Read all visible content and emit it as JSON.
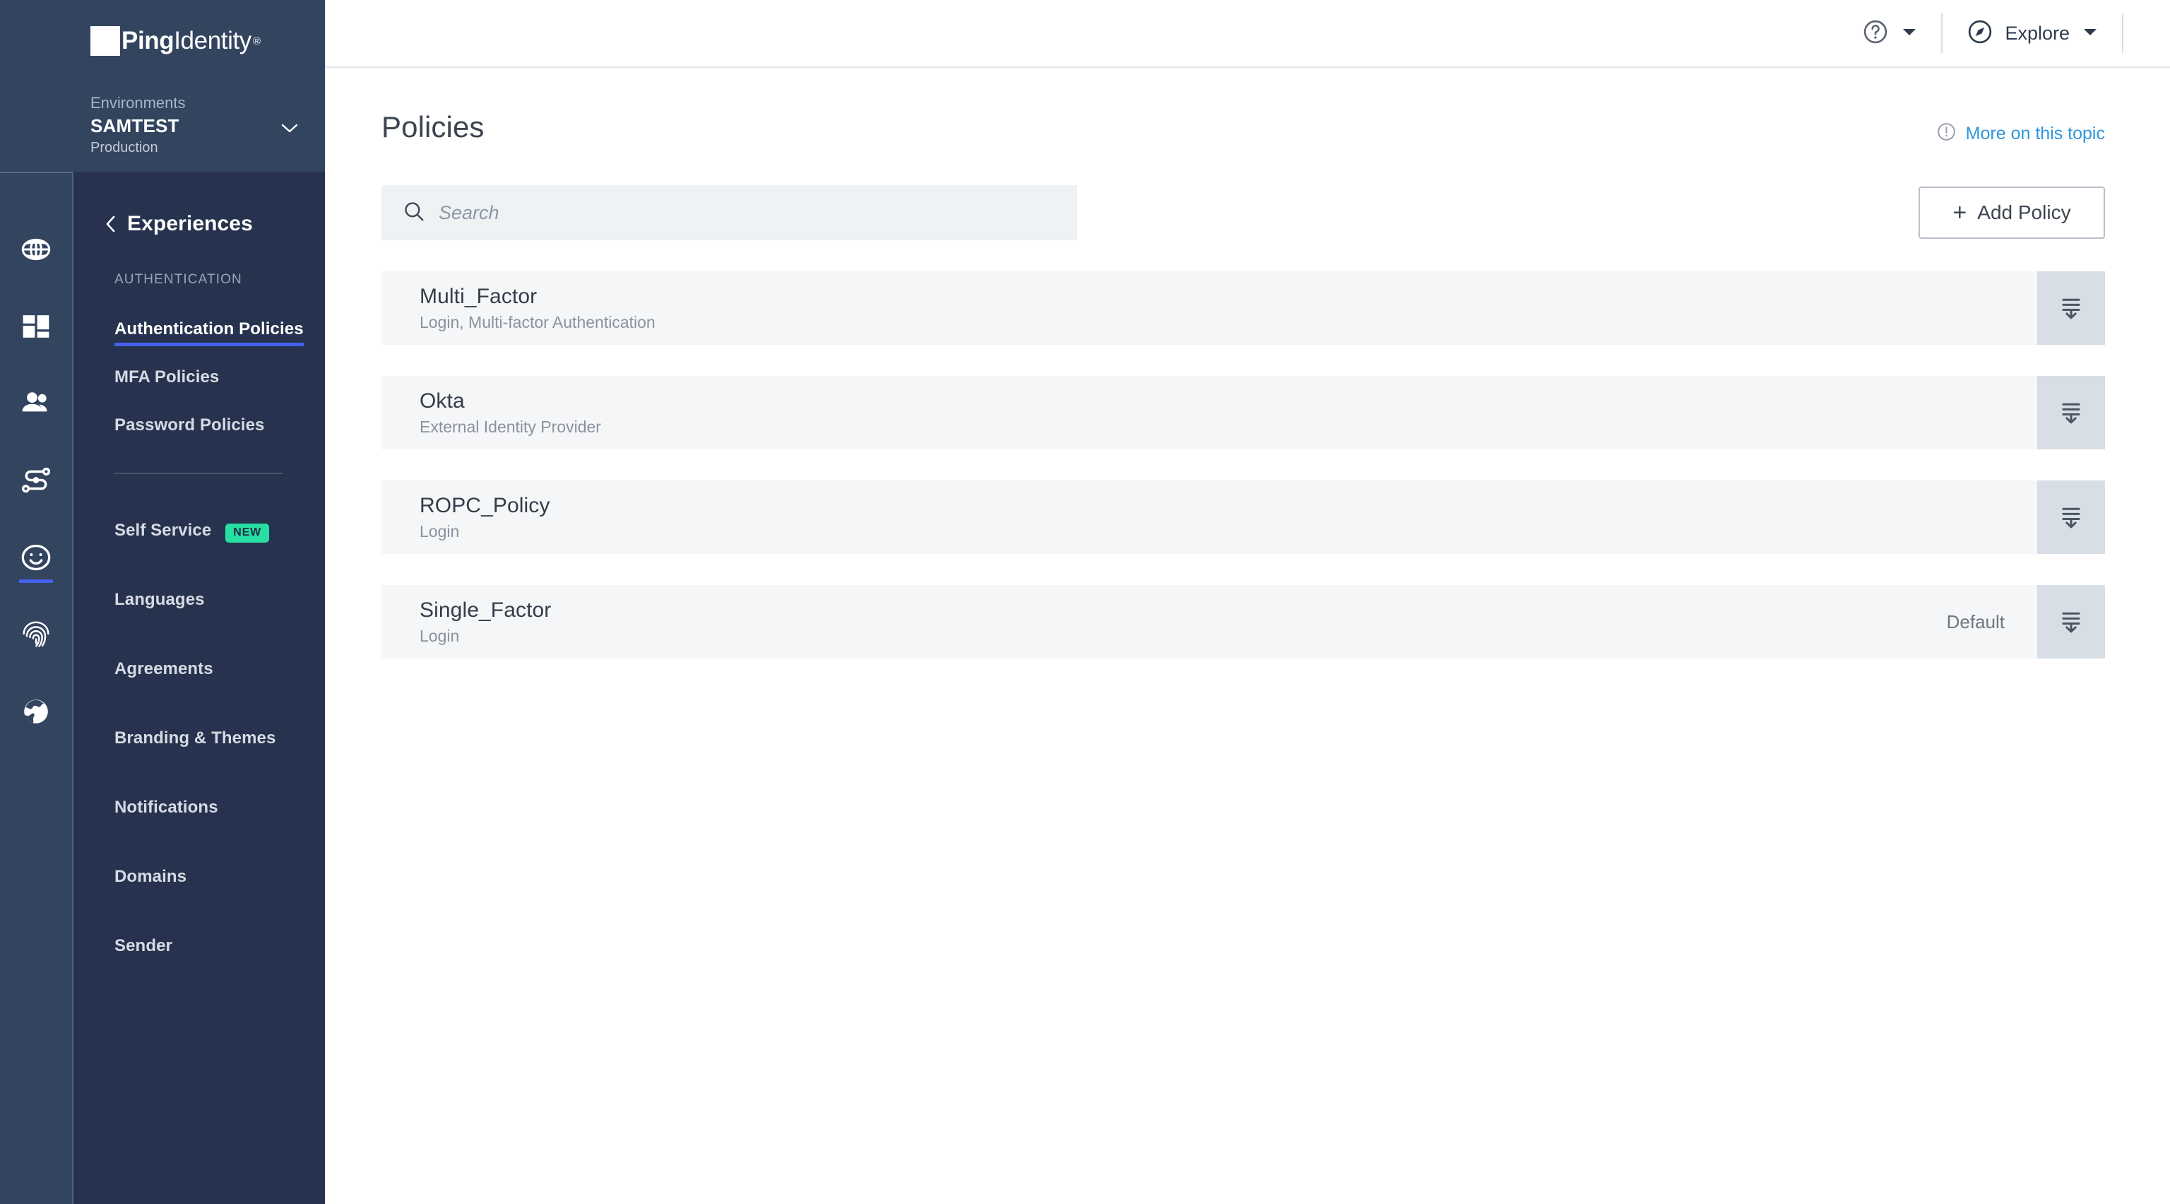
{
  "brand": {
    "logo_text_bold": "Ping",
    "logo_text_light": "Identity",
    "logo_registered": "®"
  },
  "environment": {
    "label": "Environments",
    "name": "SAMTEST",
    "type": "Production"
  },
  "rail": {
    "items": [
      {
        "icon": "globe-network-icon",
        "name": "overview"
      },
      {
        "icon": "dashboard-grid-icon",
        "name": "dashboard"
      },
      {
        "icon": "users-icon",
        "name": "identities"
      },
      {
        "icon": "connections-flow-icon",
        "name": "connections"
      },
      {
        "icon": "experience-smiley-icon",
        "name": "experiences",
        "active": true
      },
      {
        "icon": "fingerprint-icon",
        "name": "authentication"
      },
      {
        "icon": "world-globe-icon",
        "name": "integrations"
      }
    ]
  },
  "subnav": {
    "back_label": "Experiences",
    "section_label": "AUTHENTICATION",
    "primary_items": [
      {
        "label": "Authentication Policies",
        "active": true
      },
      {
        "label": "MFA Policies",
        "active": false
      },
      {
        "label": "Password Policies",
        "active": false
      }
    ],
    "secondary_items": [
      {
        "label": "Self Service",
        "badge": "NEW"
      },
      {
        "label": "Languages",
        "badge": ""
      },
      {
        "label": "Agreements",
        "badge": ""
      },
      {
        "label": "Branding & Themes",
        "badge": ""
      },
      {
        "label": "Notifications",
        "badge": ""
      },
      {
        "label": "Domains",
        "badge": ""
      },
      {
        "label": "Sender",
        "badge": ""
      }
    ]
  },
  "topbar": {
    "help_icon": "help-circle-icon",
    "explore_icon": "compass-icon",
    "explore_label": "Explore"
  },
  "page": {
    "title": "Policies",
    "topic_link": "More on this topic",
    "topic_icon": "info-exclamation-icon"
  },
  "search": {
    "placeholder": "Search",
    "value": "",
    "icon": "search-icon"
  },
  "add_button": {
    "plus": "+",
    "label": "Add Policy"
  },
  "policies": [
    {
      "name": "Multi_Factor",
      "description": "Login, Multi-factor Authentication",
      "default_label": ""
    },
    {
      "name": "Okta",
      "description": "External Identity Provider",
      "default_label": ""
    },
    {
      "name": "ROPC_Policy",
      "description": "Login",
      "default_label": ""
    },
    {
      "name": "Single_Factor",
      "description": "Login",
      "default_label": "Default"
    }
  ],
  "colors": {
    "rail_bg": "#33445f",
    "subnav_bg": "#27334e",
    "accent_blue": "#4462ed",
    "badge_green": "#27dfa2",
    "link_blue": "#2f96da",
    "row_bg": "#f5f6f8",
    "handle_bg": "#d8dee5",
    "search_bg": "#eef2f5"
  }
}
